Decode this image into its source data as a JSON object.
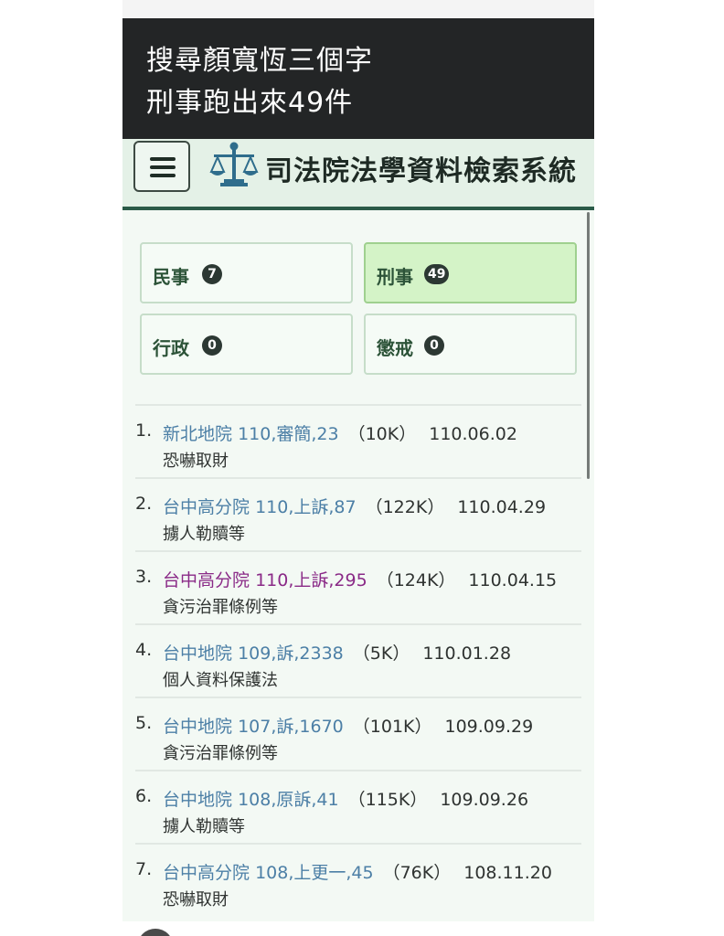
{
  "caption": {
    "line1": "搜尋顏寬恆三個字",
    "line2": "刑事跑出來49件"
  },
  "header": {
    "menu_icon": "hamburger-menu-icon",
    "logo_icon": "scales-of-justice-icon",
    "title": "司法院法學資料檢索系統"
  },
  "categories": [
    {
      "label": "民事",
      "count": "7",
      "active": false
    },
    {
      "label": "刑事",
      "count": "49",
      "active": true
    },
    {
      "label": "行政",
      "count": "0",
      "active": false
    },
    {
      "label": "懲戒",
      "count": "0",
      "active": false
    }
  ],
  "results": [
    {
      "num": "1.",
      "court": "新北地院",
      "case": "110,審簡,23",
      "size": "（10K）",
      "date": "110.06.02",
      "subject": "恐嚇取財",
      "visited": false
    },
    {
      "num": "2.",
      "court": "台中高分院",
      "case": "110,上訴,87",
      "size": "（122K）",
      "date": "110.04.29",
      "subject": "擄人勒贖等",
      "visited": false
    },
    {
      "num": "3.",
      "court": "台中高分院",
      "case": "110,上訴,295",
      "size": "（124K）",
      "date": "110.04.15",
      "subject": "貪污治罪條例等",
      "visited": true
    },
    {
      "num": "4.",
      "court": "台中地院",
      "case": "109,訴,2338",
      "size": "（5K）",
      "date": "110.01.28",
      "subject": "個人資料保護法",
      "visited": false
    },
    {
      "num": "5.",
      "court": "台中地院",
      "case": "107,訴,1670",
      "size": "（101K）",
      "date": "109.09.29",
      "subject": "貪污治罪條例等",
      "visited": false
    },
    {
      "num": "6.",
      "court": "台中地院",
      "case": "108,原訴,41",
      "size": "（115K）",
      "date": "109.09.26",
      "subject": "擄人勒贖等",
      "visited": false
    },
    {
      "num": "7.",
      "court": "台中高分院",
      "case": "108,上更一,45",
      "size": "（76K）",
      "date": "108.11.20",
      "subject": "恐嚇取財",
      "visited": false
    }
  ],
  "colors": {
    "caption_bg": "#232526",
    "header_bg": "#e4f1e7",
    "header_border": "#2a5a48",
    "active_category_bg": "#d4f3c7",
    "link": "#4c7fa6",
    "visited_link": "#8a2a87"
  }
}
